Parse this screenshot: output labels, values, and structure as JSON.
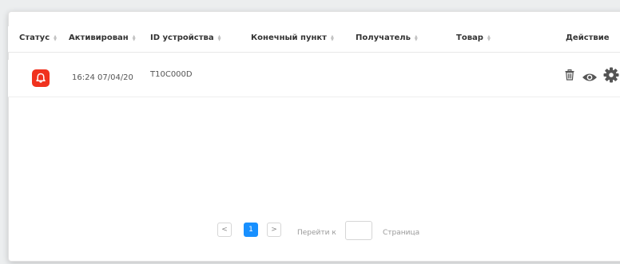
{
  "table": {
    "columns": [
      "Статус",
      "Активирован",
      "ID устройства",
      "Конечный пункт",
      "Получатель",
      "Товар",
      "Действие"
    ],
    "rows": [
      {
        "status_icon": "alarm-bell-icon",
        "activated": "16:24 07/04/20",
        "device_id": "T10C000D",
        "endpoint": "",
        "recipient": "",
        "goods": "",
        "actions": [
          "trash-icon",
          "eye-icon",
          "gear-icon"
        ]
      }
    ]
  },
  "pagination": {
    "prev": "<",
    "current_page": "1",
    "next": ">",
    "goto_label": "Перейти к",
    "goto_value": "",
    "page_label": "Страница"
  },
  "colors": {
    "status_alert": "#f0321e",
    "active_page": "#1890ff"
  }
}
